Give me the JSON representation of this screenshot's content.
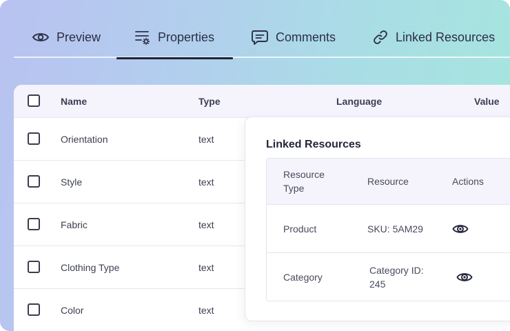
{
  "tabs": [
    {
      "label": "Preview",
      "icon": "eye-icon",
      "active": false
    },
    {
      "label": "Properties",
      "icon": "properties-icon",
      "active": true
    },
    {
      "label": "Comments",
      "icon": "comment-icon",
      "active": false
    },
    {
      "label": "Linked Resources",
      "icon": "link-icon",
      "active": false
    }
  ],
  "properties_table": {
    "columns": [
      "Name",
      "Type",
      "Language",
      "Value"
    ],
    "rows": [
      {
        "name": "Orientation",
        "type": "text"
      },
      {
        "name": "Style",
        "type": "text"
      },
      {
        "name": "Fabric",
        "type": "text"
      },
      {
        "name": "Clothing Type",
        "type": "text"
      },
      {
        "name": "Color",
        "type": "text"
      }
    ]
  },
  "linked_resources": {
    "title": "Linked Resources",
    "columns": [
      "Resource Type",
      "Resource",
      "Actions"
    ],
    "rows": [
      {
        "resource_type": "Product",
        "resource": "SKU: 5AM29",
        "action_icon": "eye-icon"
      },
      {
        "resource_type": "Category",
        "resource": "Category ID: 245",
        "action_icon": "eye-icon"
      }
    ]
  },
  "colors": {
    "gradient_start": "#b9c2f0",
    "gradient_end": "#a6e6dc",
    "header_bg": "#f5f4fd",
    "text": "#2b2f45"
  }
}
